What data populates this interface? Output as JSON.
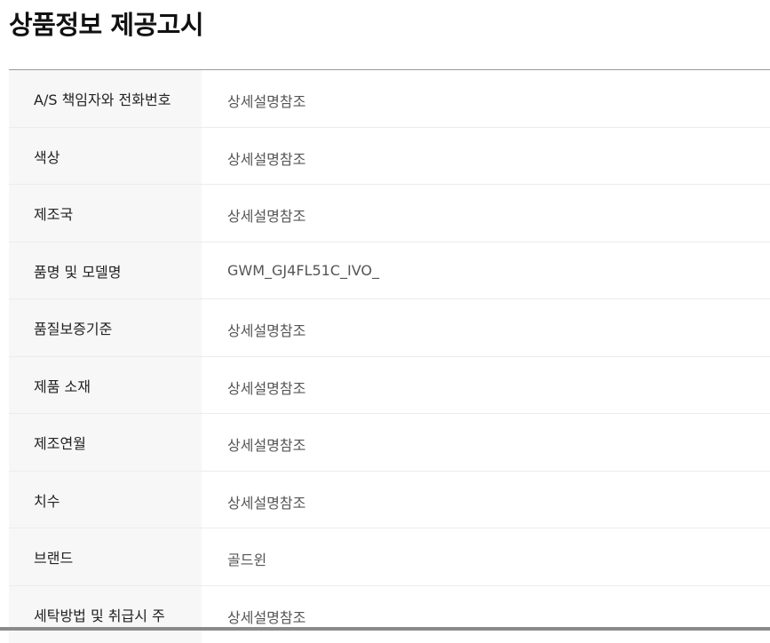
{
  "title": "상품정보 제공고시",
  "rows": [
    {
      "label": "A/S 책임자와 전화번호",
      "value": "상세설명참조"
    },
    {
      "label": "색상",
      "value": "상세설명참조"
    },
    {
      "label": "제조국",
      "value": "상세설명참조"
    },
    {
      "label": "품명 및 모델명",
      "value": "GWM_GJ4FL51C_IVO_"
    },
    {
      "label": "품질보증기준",
      "value": "상세설명참조"
    },
    {
      "label": "제품 소재",
      "value": "상세설명참조"
    },
    {
      "label": "제조연월",
      "value": "상세설명참조"
    },
    {
      "label": "치수",
      "value": "상세설명참조"
    },
    {
      "label": "브랜드",
      "value": "골드윈"
    },
    {
      "label": "세탁방법 및 취급시 주",
      "value": "상세설명참조"
    }
  ]
}
